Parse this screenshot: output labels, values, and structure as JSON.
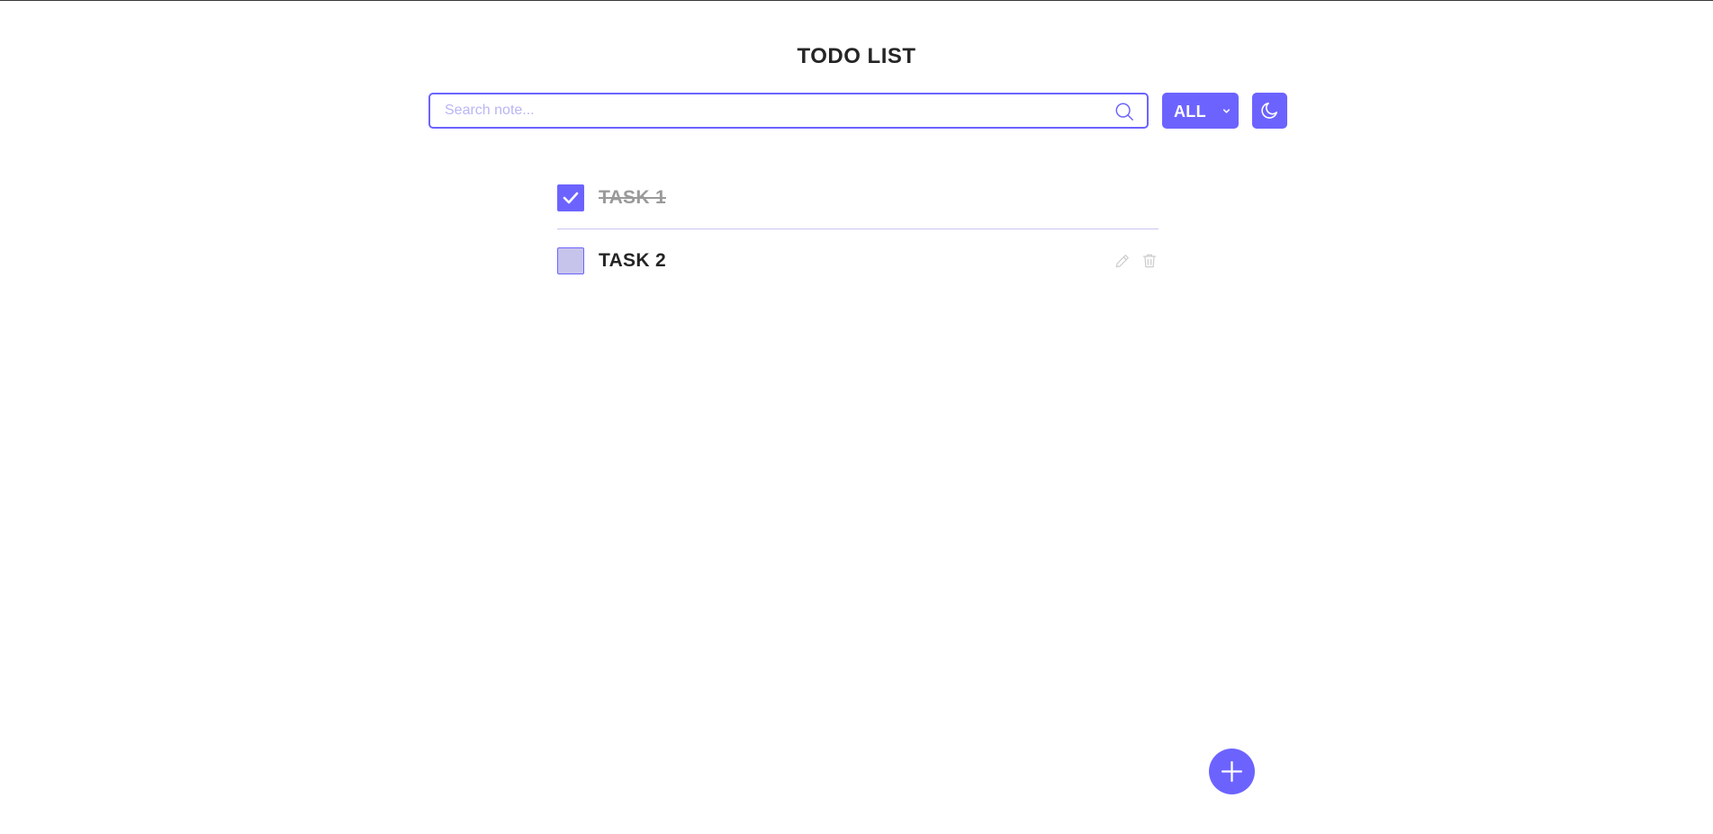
{
  "page": {
    "title": "TODO LIST"
  },
  "toolbar": {
    "search": {
      "placeholder": "Search note...",
      "value": "",
      "icon": "search-icon"
    },
    "filter": {
      "selected": "ALL",
      "icon": "chevron-down-icon"
    },
    "theme_toggle": {
      "icon": "moon-icon"
    }
  },
  "tasks": [
    {
      "label": "TASK 1",
      "completed": true
    },
    {
      "label": "TASK 2",
      "completed": false,
      "actions": [
        "pencil-icon",
        "trash-icon"
      ]
    }
  ],
  "add_button": {
    "icon": "plus-icon"
  },
  "colors": {
    "accent": "#6c63ff",
    "accent_light": "#c7c4eb",
    "text": "#252525",
    "muted_text": "#9a9a9a",
    "action_icon": "#cdcdcd",
    "divider": "#c8c5ee"
  }
}
